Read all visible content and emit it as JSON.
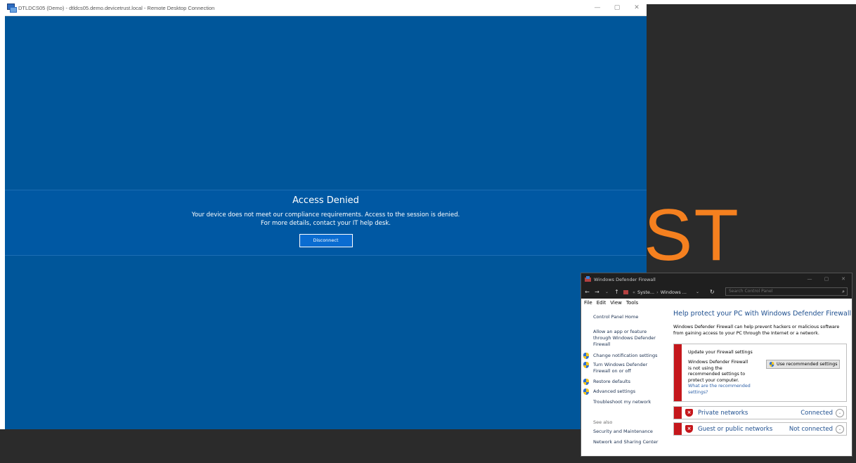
{
  "rdp": {
    "title": "DTLDCS05 (Demo) - dtldcs05.demo.devicetrust.local - Remote Desktop Connection",
    "controls": {
      "minimize": "—",
      "maximize": "▢",
      "close": "✕"
    },
    "banner": {
      "heading": "Access Denied",
      "line1": "Your device does not meet our compliance requirements. Access to the session is denied.",
      "line2": "For more details, contact your IT help desk.",
      "button": "Disconnect"
    }
  },
  "desktop": {
    "brand_fragment": "ST",
    "brand_color": "#f5801f"
  },
  "firewall": {
    "title": "Windows Defender Firewall",
    "controls": {
      "minimize": "—",
      "maximize": "▢",
      "close": "✕"
    },
    "nav": {
      "back": "←",
      "forward": "→",
      "recent": "⌄",
      "up": "↑"
    },
    "address": {
      "crumb1": "Syste...",
      "crumb2": "Windows ...",
      "dropdown": "⌄",
      "refresh": "↻"
    },
    "search": {
      "placeholder": "Search Control Panel",
      "icon": "⌕"
    },
    "menu": [
      "File",
      "Edit",
      "View",
      "Tools"
    ],
    "left": {
      "home": "Control Panel Home",
      "allow_app": "Allow an app or feature through Windows Defender Firewall",
      "change_notifications": "Change notification settings",
      "turn_on_off": "Turn Windows Defender Firewall on or off",
      "restore": "Restore defaults",
      "advanced": "Advanced settings",
      "troubleshoot": "Troubleshoot my network",
      "see_also": "See also",
      "security_maintenance": "Security and Maintenance",
      "network_sharing": "Network and Sharing Center"
    },
    "main": {
      "heading": "Help protect your PC with Windows Defender Firewall",
      "description": "Windows Defender Firewall can help prevent hackers or malicious software from gaining access to your PC through the Internet or a network.",
      "update_title": "Update your Firewall settings",
      "warning": "Windows Defender Firewall is not using the recommended settings to protect your computer.",
      "what_link": "What are the recommended settings?",
      "use_recommended": "Use recommended settings",
      "networks": [
        {
          "name": "Private networks",
          "state": "Connected"
        },
        {
          "name": "Guest or public networks",
          "state": "Not connected"
        }
      ]
    }
  }
}
